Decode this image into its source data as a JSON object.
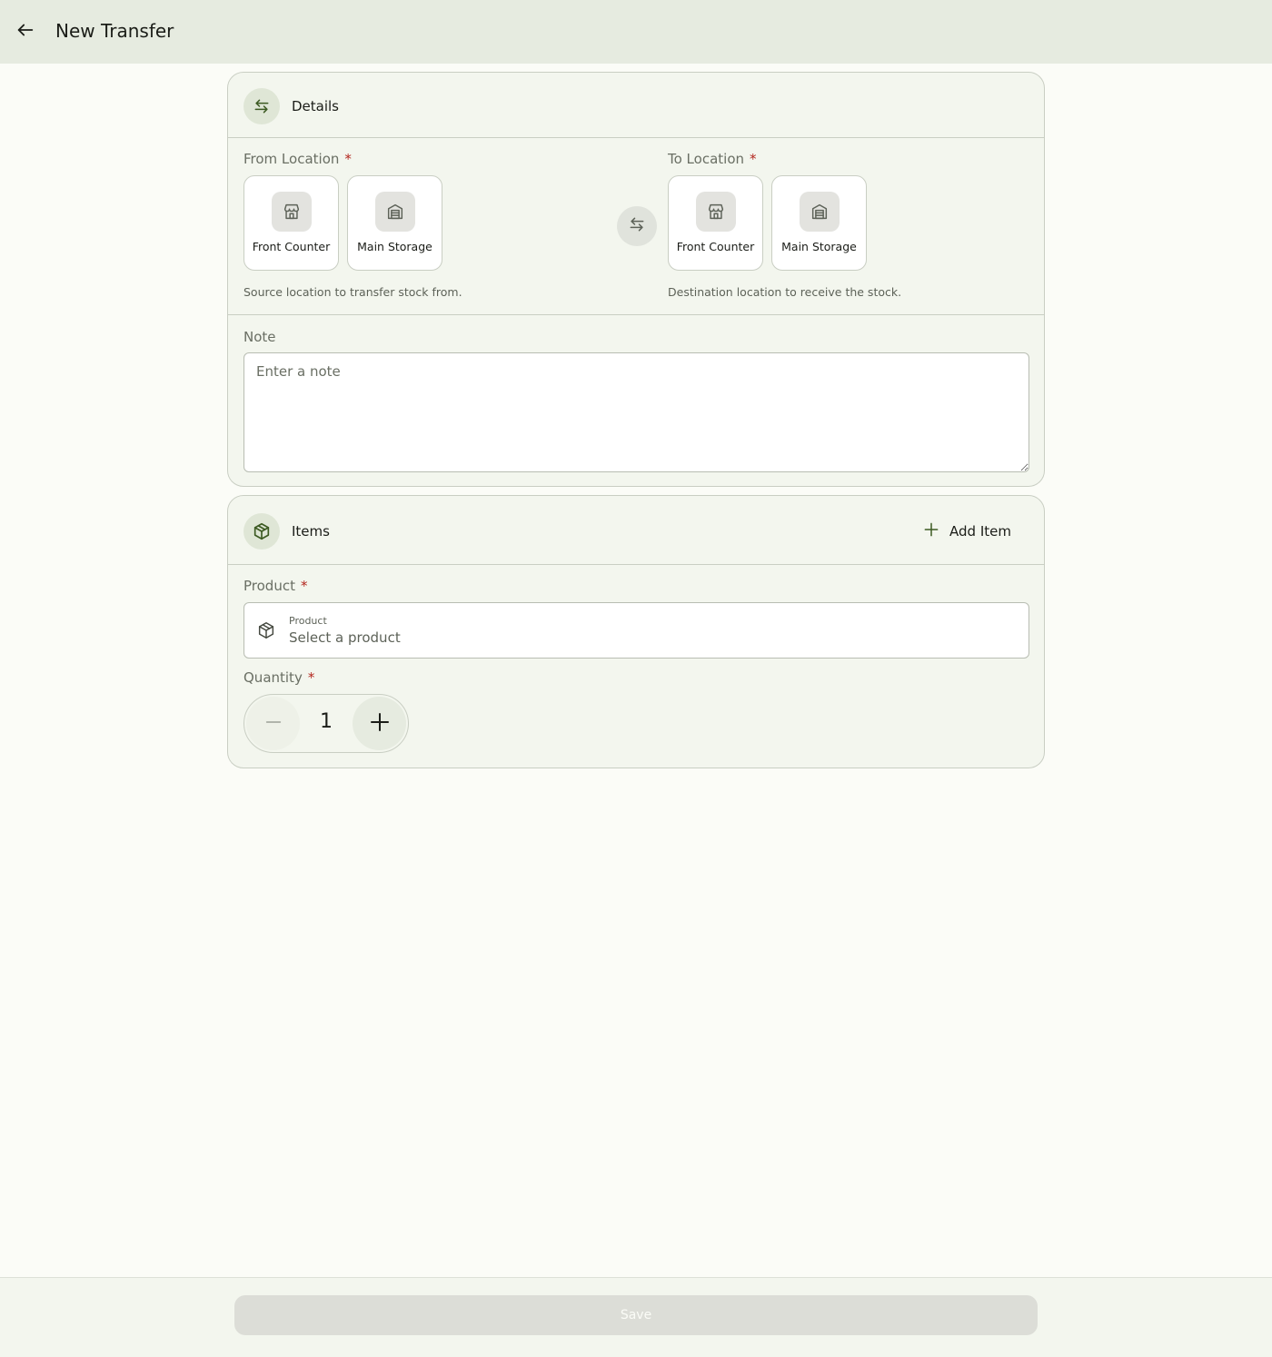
{
  "header": {
    "title": "New Transfer",
    "back_icon": "arrow-left-icon"
  },
  "details": {
    "title": "Details",
    "icon": "swap-arrows-icon",
    "from": {
      "label": "From Location",
      "required_mark": "*",
      "options": [
        {
          "label": "Front Counter",
          "icon": "storefront-icon"
        },
        {
          "label": "Main Storage",
          "icon": "warehouse-icon"
        }
      ],
      "helper": "Source location to transfer stock from."
    },
    "to": {
      "label": "To Location",
      "required_mark": "*",
      "options": [
        {
          "label": "Front Counter",
          "icon": "storefront-icon"
        },
        {
          "label": "Main Storage",
          "icon": "warehouse-icon"
        }
      ],
      "helper": "Destination location to receive the stock."
    },
    "swap_icon": "swap-arrows-icon",
    "note": {
      "label": "Note",
      "placeholder": "Enter a note",
      "value": ""
    }
  },
  "items": {
    "title": "Items",
    "icon": "package-icon",
    "add_label": "Add Item",
    "product": {
      "label": "Product",
      "required_mark": "*",
      "field_label": "Product",
      "placeholder": "Select a product"
    },
    "quantity": {
      "label": "Quantity",
      "required_mark": "*",
      "value": "1"
    }
  },
  "footer": {
    "save_label": "Save",
    "save_enabled": false
  },
  "colors": {
    "topbar_bg": "#e6ebe0",
    "page_bg": "#fbfcf7",
    "card_bg": "#f3f6ee",
    "accent": "#3c5a22",
    "required": "#b3261e",
    "save_disabled_bg": "#dcddd7"
  }
}
